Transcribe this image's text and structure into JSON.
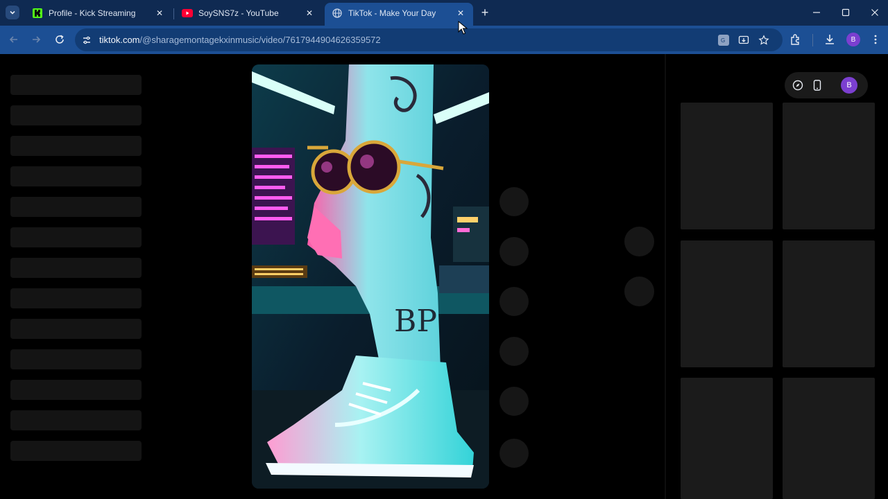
{
  "browser": {
    "tabs": [
      {
        "title": "Profile - Kick Streaming",
        "favicon": "kick-icon",
        "active": false
      },
      {
        "title": "SoySNS7z - YouTube",
        "favicon": "youtube-icon",
        "active": false
      },
      {
        "title": "TikTok - Make Your Day",
        "favicon": "globe-icon",
        "active": true
      }
    ],
    "new_tab_label": "+",
    "address": {
      "domain": "tiktok.com",
      "path": "/@sharagemontagekxinmusic/video/7617944904626359572"
    },
    "profile_initial": "B"
  },
  "page": {
    "profile_pill_initial": "B"
  },
  "colors": {
    "tabstrip": "#0f2a52",
    "toolbar": "#1c4f94",
    "skeleton": "#141414",
    "profile": "#7b3fd0"
  }
}
